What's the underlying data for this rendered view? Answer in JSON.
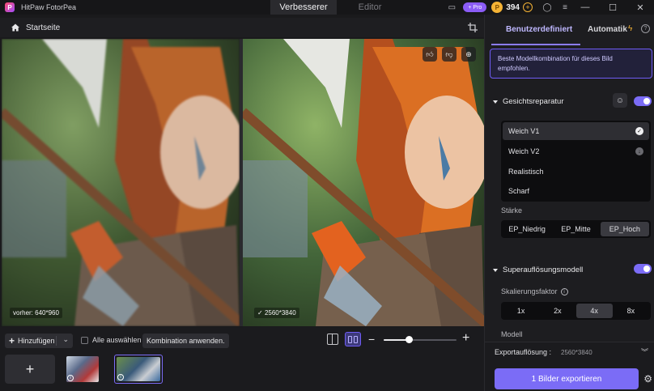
{
  "app": {
    "title": "HitPaw FotorPea",
    "logo_letter": "P"
  },
  "tabs": [
    {
      "label": "Verbesserer",
      "active": true
    },
    {
      "label": "Editor",
      "active": false
    }
  ],
  "account": {
    "pro_label": "+ Pro",
    "credits": "394"
  },
  "breadcrumb": {
    "label": "Startseite"
  },
  "preview": {
    "before_label": "vorher: 640*960",
    "after_label": "2560*3840",
    "after_check": "✓"
  },
  "toolbar": {
    "add_label": "Hinzufügen",
    "select_all_label": "Alle auswählen",
    "apply_label": "Kombination anwenden."
  },
  "panel": {
    "tab_custom": "Benutzerdefiniert",
    "tab_auto": "Automatik",
    "recommend_text": "Beste Modellkombination für dieses Bild empfohlen.",
    "face": {
      "title": "Gesichtsreparatur",
      "enabled": true,
      "models": [
        {
          "label": "Weich V1",
          "selected": true
        },
        {
          "label": "Weich V2",
          "selected": false
        },
        {
          "label": "Realistisch",
          "selected": false
        },
        {
          "label": "Scharf",
          "selected": false
        }
      ],
      "strength_label": "Stärke",
      "strength_options": [
        {
          "label": "EP_Niedrig",
          "selected": false
        },
        {
          "label": "EP_Mitte",
          "selected": false
        },
        {
          "label": "EP_Hoch",
          "selected": true
        }
      ]
    },
    "superres": {
      "title": "Superauflösungsmodell",
      "enabled": true,
      "scale_label": "Skalierungsfaktor",
      "scale_options": [
        {
          "label": "1x",
          "selected": false
        },
        {
          "label": "2x",
          "selected": false
        },
        {
          "label": "4x",
          "selected": true
        },
        {
          "label": "8x",
          "selected": false
        }
      ],
      "model_label": "Modell"
    },
    "export": {
      "res_label": "Exportauflösung :",
      "res_value": "2560*3840",
      "button_label": "1 Bilder exportieren"
    }
  },
  "zoom": {
    "level": 0.35
  },
  "colors": {
    "accent": "#7b6cf6",
    "coin": "#f5b335"
  }
}
